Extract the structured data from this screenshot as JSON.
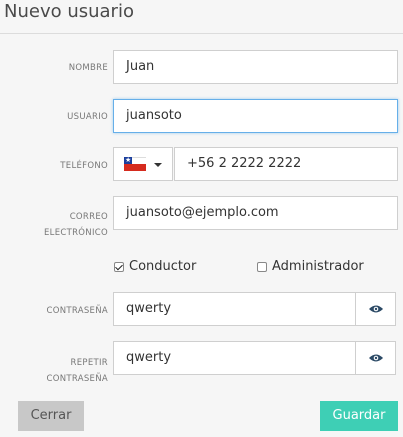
{
  "title": "Nuevo usuario",
  "fields": {
    "nombre": {
      "label": "NOMBRE",
      "value": "Juan"
    },
    "usuario": {
      "label": "USUARIO",
      "value": "juansoto"
    },
    "telefono": {
      "label": "TELÉFONO",
      "value": "+56 2 2222 2222",
      "country": "Chile"
    },
    "correo": {
      "label_line1": "CORREO",
      "label_line2": "ELECTRÓNICO",
      "value": "juansoto@ejemplo.com"
    },
    "contrasena": {
      "label": "CONTRASEÑA",
      "value": "qwerty"
    },
    "repetir": {
      "label_line1": "REPETIR",
      "label_line2": "CONTRASEÑA",
      "value": "qwerty"
    }
  },
  "roles": {
    "conductor": {
      "label": "Conductor",
      "checked": true
    },
    "administrador": {
      "label": "Administrador",
      "checked": false
    }
  },
  "buttons": {
    "close": "Cerrar",
    "save": "Guardar"
  },
  "colors": {
    "save": "#3ecfb5",
    "close": "#c8c8c8",
    "focus": "#66afe9"
  },
  "icons": {
    "password_toggle": "eye-icon",
    "phone_dropdown": "caret-down-icon"
  }
}
